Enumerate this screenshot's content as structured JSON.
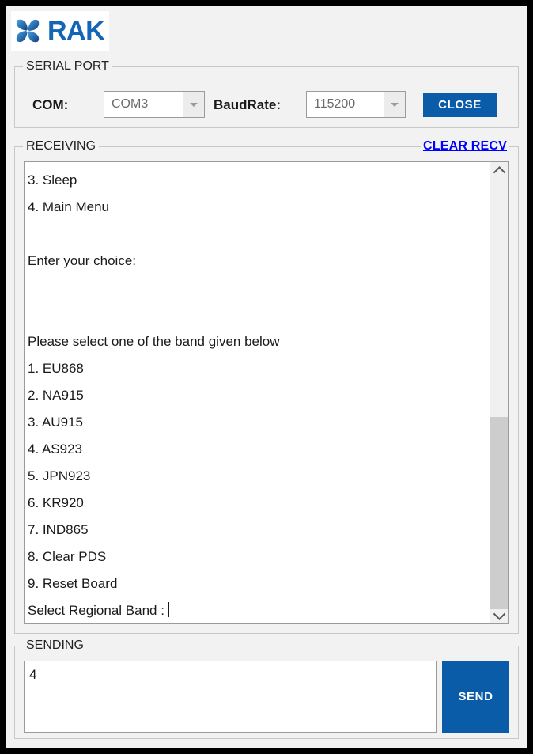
{
  "app": {
    "brand_text": "RAK",
    "brand_color": "#1266b5",
    "accent_color": "#0b5ca8",
    "link_color": "#0000ff",
    "logo_icon": "rak-pinwheel-logo"
  },
  "serial_port": {
    "group_label": "SERIAL PORT",
    "com_label": "COM:",
    "com_value": "COM3",
    "baud_label": "BaudRate:",
    "baud_value": "115200",
    "close_button": "CLOSE"
  },
  "receiving": {
    "group_label": "RECEIVING",
    "clear_link": "CLEAR RECV",
    "lines": [
      "3. Sleep",
      "4. Main Menu",
      "",
      "Enter your choice:",
      "",
      "",
      "Please select one of the band given below",
      "1. EU868",
      "2. NA915",
      "3. AU915",
      "4. AS923",
      "5. JPN923",
      "6. KR920",
      "7. IND865",
      "8. Clear PDS",
      "9. Reset Board",
      "Select Regional Band : "
    ],
    "scrollbar": {
      "up_icon": "chevron-up-icon",
      "down_icon": "chevron-down-icon"
    }
  },
  "sending": {
    "group_label": "SENDING",
    "value": "4",
    "placeholder": "",
    "send_button": "SEND"
  }
}
